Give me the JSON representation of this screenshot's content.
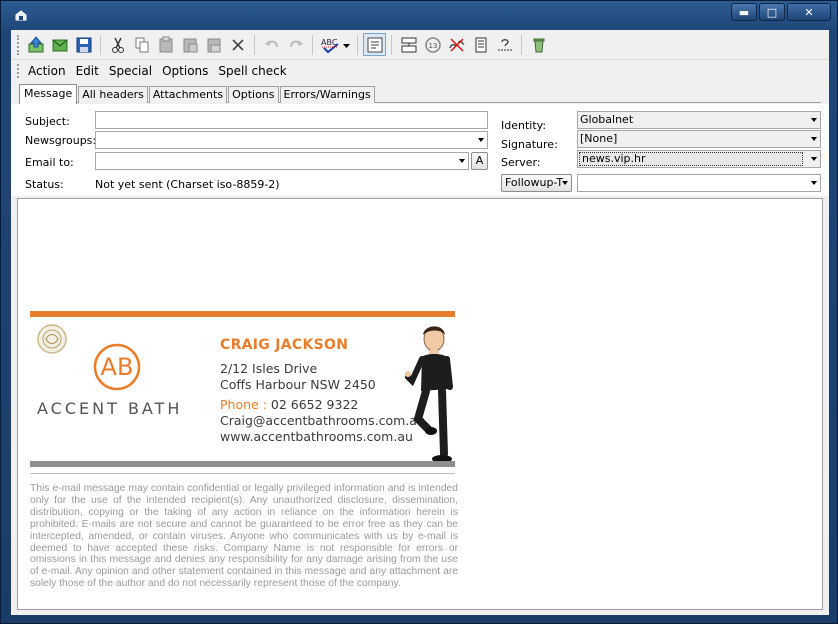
{
  "toolbar": {
    "icons": [
      "send-icon",
      "send-later-icon",
      "save-icon",
      "cut-icon",
      "copy-icon",
      "paste-icon",
      "paste-quoted-icon",
      "paste-special-icon",
      "delete-icon",
      "undo-icon",
      "redo-icon",
      "spell-check-icon",
      "spell-check-dropdown-icon",
      "word-wrap-icon",
      "format-icon",
      "rot13-icon",
      "no-signature-icon",
      "attach-icon",
      "insert-icon",
      "trash-icon"
    ]
  },
  "menu": {
    "items": [
      "Action",
      "Edit",
      "Special",
      "Options",
      "Spell check"
    ]
  },
  "tabs": [
    "Message",
    "All headers",
    "Attachments",
    "Options",
    "Errors/Warnings"
  ],
  "form": {
    "subject_label": "Subject:",
    "subject_value": "",
    "newsgroups_label": "Newsgroups:",
    "newsgroups_value": "",
    "emailto_label": "Email to:",
    "emailto_value": "",
    "addressbook_btn": "A",
    "status_label": "Status:",
    "status_value": "Not yet sent (Charset iso-8859-2)",
    "identity_label": "Identity:",
    "identity_value": "Globalnet",
    "signature_label": "Signature:",
    "signature_value": "[None]",
    "server_label": "Server:",
    "server_value": "news.vip.hr",
    "followup_btn": "Followup-T",
    "followup_value": ""
  },
  "signature_card": {
    "brand_initials": "AB",
    "brand_name": "ACCENT BATH",
    "name": "CRAIG JACKSON",
    "address1": "2/12 Isles Drive",
    "address2": "Coffs Harbour NSW 2450",
    "phone_label": "Phone :",
    "phone": "02 6652 9322",
    "email": "Craig@accentbathrooms.com.au",
    "website": "www.accentbathrooms.com.au"
  },
  "disclaimer": "This e-mail message may contain confidential or legally privileged information and is intended only for the use of the intended recipient(s). Any unauthorized disclosure, dissemination, distribution, copying or the taking of any action in reliance on the information herein is prohibited. E-mails are not secure and cannot be guaranteed to be error free as they can be intercepted, amended, or contain viruses. Anyone who communicates with us by e-mail is deemed to have accepted these risks. Company Name is not responsible for errors or omissions in this message and denies any responsibility for any damage arising from the use of e-mail. Any opinion and other statement contained in this message and any attachment are solely those of the author and do not necessarily represent those of the company.",
  "colors": {
    "accent": "#e87d2c",
    "bar_gray": "#8f8f8f",
    "frame": "#1f4678"
  }
}
